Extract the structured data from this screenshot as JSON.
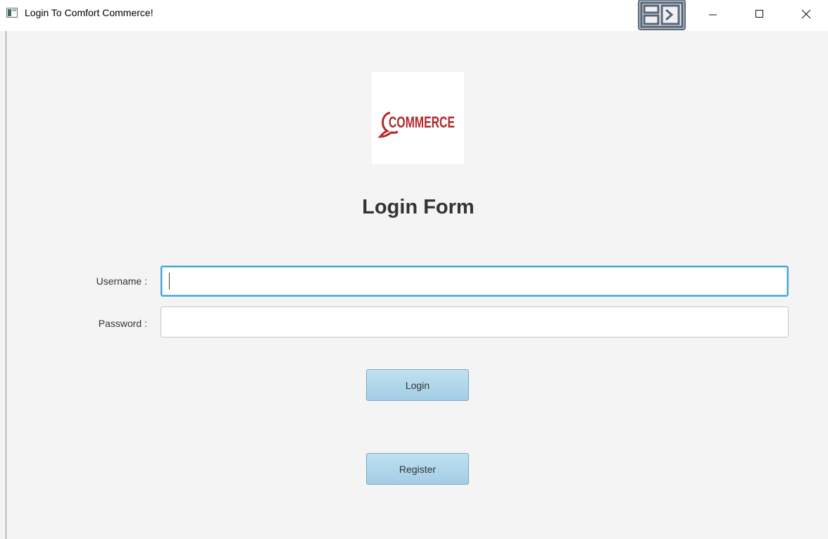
{
  "window": {
    "title": "Login To Comfort Commerce!",
    "icon": "app-window-icon"
  },
  "titlebar_buttons": {
    "snap": "snap-layout-icon",
    "minimize": "minimize-icon",
    "maximize": "maximize-icon",
    "close": "close-icon"
  },
  "logo": {
    "text": "COMMERCE",
    "color": "#b22a2a"
  },
  "form": {
    "title": "Login Form",
    "username_label": "Username :",
    "username_value": "",
    "password_label": "Password :",
    "password_value": "",
    "login_label": "Login",
    "register_label": "Register"
  },
  "colors": {
    "background": "#f4f4f4",
    "focus_border": "#3fa5d9",
    "button_fill": "#b2d7eb"
  }
}
